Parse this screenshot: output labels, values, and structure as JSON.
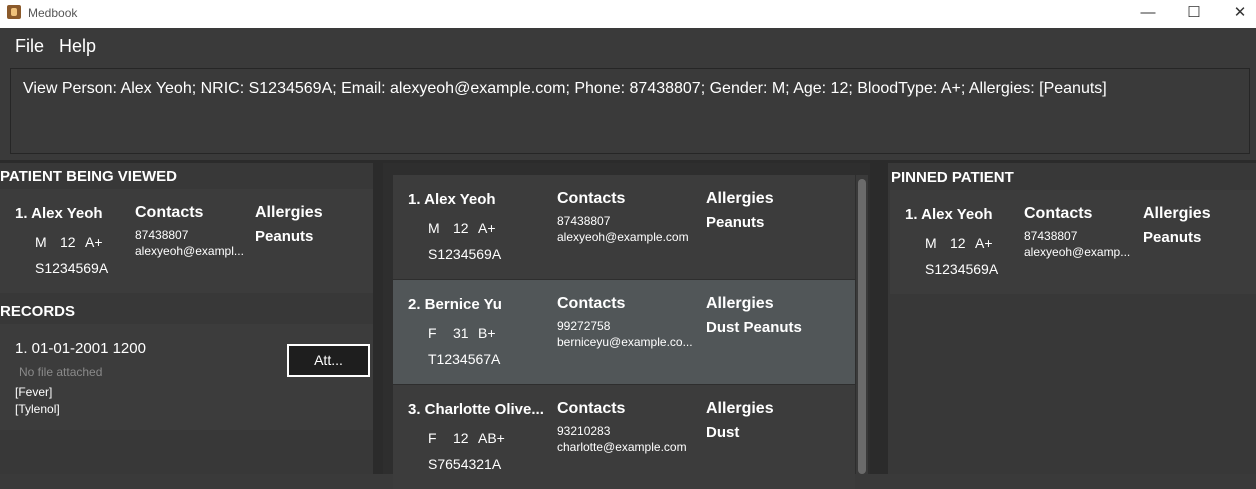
{
  "window": {
    "title": "Medbook",
    "minimize": "—",
    "maximize": "☐",
    "close": "✕"
  },
  "menu": {
    "file": "File",
    "help": "Help"
  },
  "result": {
    "text": "View Person: Alex Yeoh; NRIC: S1234569A; Email: alexyeoh@example.com; Phone: 87438807; Gender: M; Age: 12; BloodType: A+; Allergies: [Peanuts]"
  },
  "viewed": {
    "heading": "PATIENT BEING VIEWED",
    "name": "1. Alex Yeoh",
    "gender": "M",
    "age": "12",
    "blood": "A+",
    "nric": "S1234569A",
    "contacts_label": "Contacts",
    "phone": "87438807",
    "email": "alexyeoh@exampl...",
    "allergies_label": "Allergies",
    "allergies": "Peanuts"
  },
  "records": {
    "heading": "RECORDS",
    "items": [
      {
        "title": "1. 01-01-2001 1200",
        "file": "No file attached",
        "condition": "[Fever]",
        "medication": "[Tylenol]",
        "attach_label": "Att..."
      }
    ]
  },
  "patients": [
    {
      "name": "1. Alex Yeoh",
      "gender": "M",
      "age": "12",
      "blood": "A+",
      "nric": "S1234569A",
      "contacts_label": "Contacts",
      "phone": "87438807",
      "email": "alexyeoh@example.com",
      "allergies_label": "Allergies",
      "allergies": "Peanuts"
    },
    {
      "name": "2. Bernice Yu",
      "gender": "F",
      "age": "31",
      "blood": "B+",
      "nric": "T1234567A",
      "contacts_label": "Contacts",
      "phone": "99272758",
      "email": "berniceyu@example.co...",
      "allergies_label": "Allergies",
      "allergies": "Dust Peanuts"
    },
    {
      "name": "3. Charlotte Olive...",
      "gender": "F",
      "age": "12",
      "blood": "AB+",
      "nric": "S7654321A",
      "contacts_label": "Contacts",
      "phone": "93210283",
      "email": "charlotte@example.com",
      "allergies_label": "Allergies",
      "allergies": "Dust"
    }
  ],
  "pinned": {
    "heading": "PINNED PATIENT",
    "name": "1. Alex Yeoh",
    "gender": "M",
    "age": "12",
    "blood": "A+",
    "nric": "S1234569A",
    "contacts_label": "Contacts",
    "phone": "87438807",
    "email": "alexyeoh@examp...",
    "allergies_label": "Allergies",
    "allergies": "Peanuts"
  }
}
